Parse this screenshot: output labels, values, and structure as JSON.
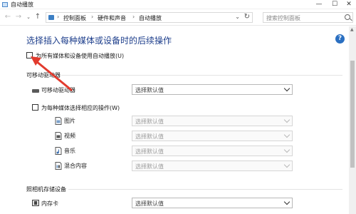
{
  "window": {
    "title": "自动播放"
  },
  "address": {
    "crumbs": [
      "控制面板",
      "硬件和声音",
      "自动播放"
    ]
  },
  "search": {
    "placeholder": "搜索控制面板"
  },
  "main": {
    "heading": "选择插入每种媒体或设备时的后续操作",
    "use_autoplay_all": "为所有媒体和设备使用自动播放(U)",
    "removable_section": "可移动驱动器",
    "removable_drive_label": "可移动驱动器",
    "removable_drive_value": "选择默认值",
    "choose_each_label": "为每种媒体选择相应的操作(W)",
    "media_rows": [
      {
        "label": "图片",
        "value": "选择默认值",
        "icon": "picture-icon"
      },
      {
        "label": "视频",
        "value": "选择默认值",
        "icon": "video-icon"
      },
      {
        "label": "音乐",
        "value": "选择默认值",
        "icon": "music-icon"
      },
      {
        "label": "混合内容",
        "value": "选择默认值",
        "icon": "mixed-content-icon"
      }
    ],
    "camera_section": "照相机存储设备",
    "memory_card_label": "内存卡",
    "memory_card_value": "选择默认值"
  },
  "colors": {
    "heading": "#1e3f8c",
    "arrow": "#e23b2e",
    "help": "#2a6fc1"
  }
}
